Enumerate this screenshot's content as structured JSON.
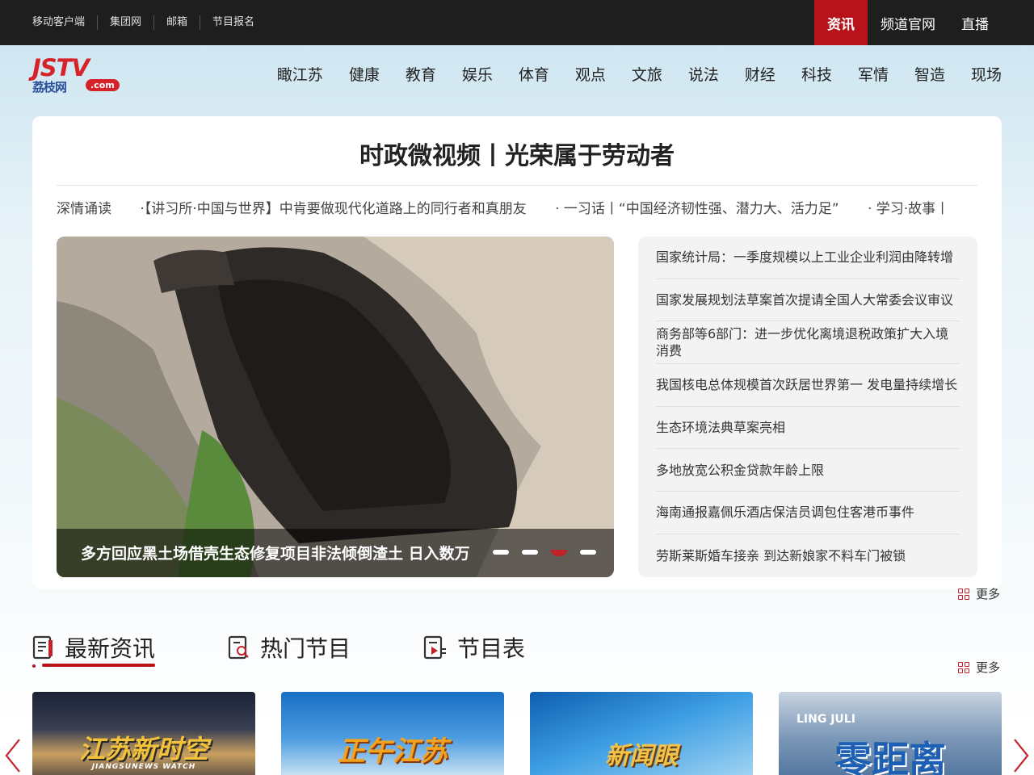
{
  "topbar": {
    "links": [
      "移动客户端",
      "集团网",
      "邮箱",
      "节目报名"
    ],
    "right": [
      "资讯",
      "频道官网",
      "直播"
    ]
  },
  "logo": {
    "main": "JSTV",
    "sub": "荔枝网",
    "dot": ".com"
  },
  "nav": [
    "瞰江苏",
    "健康",
    "教育",
    "娱乐",
    "体育",
    "观点",
    "文旅",
    "说法",
    "财经",
    "科技",
    "军情",
    "智造",
    "现场"
  ],
  "headline": "时政微视频丨光荣属于劳动者",
  "ticker": [
    "深情诵读",
    "·【讲习所·中国与世界】中肯要做现代化道路上的同行者和真朋友",
    "· 一习话丨“中国经济韧性强、潜力大、活力足”",
    "· 学习·故事丨"
  ],
  "slider": {
    "caption": "多方回应黑土场借壳生态修复项目非法倾倒渣土 日入数万",
    "slide_count": 4,
    "active_slide": 3
  },
  "news": [
    "国家统计局：一季度规模以上工业企业利润由降转增",
    "国家发展规划法草案首次提请全国人大常委会议审议",
    "商务部等6部门：进一步优化离境退税政策扩大入境消费",
    "我国核电总体规模首次跃居世界第一 发电量持续增长",
    "生态环境法典草案亮相",
    "多地放宽公积金贷款年龄上限",
    "海南通报嘉佩乐酒店保洁员调包住客港币事件",
    "劳斯莱斯婚车接亲 到达新娘家不料车门被锁"
  ],
  "more_label": "更多",
  "tabs": [
    "最新资讯",
    "热门节目",
    "节目表"
  ],
  "programs": [
    {
      "title": "江苏新时空",
      "sub": "JIANGSUNEWS WATCH"
    },
    {
      "title": "正午江苏",
      "sub": ""
    },
    {
      "title": "新闻眼",
      "sub": ""
    },
    {
      "title": "零距离",
      "sub": "LING JULI"
    }
  ],
  "colors": {
    "accent": "#b8121b",
    "topbar": "#1e1e1e"
  }
}
